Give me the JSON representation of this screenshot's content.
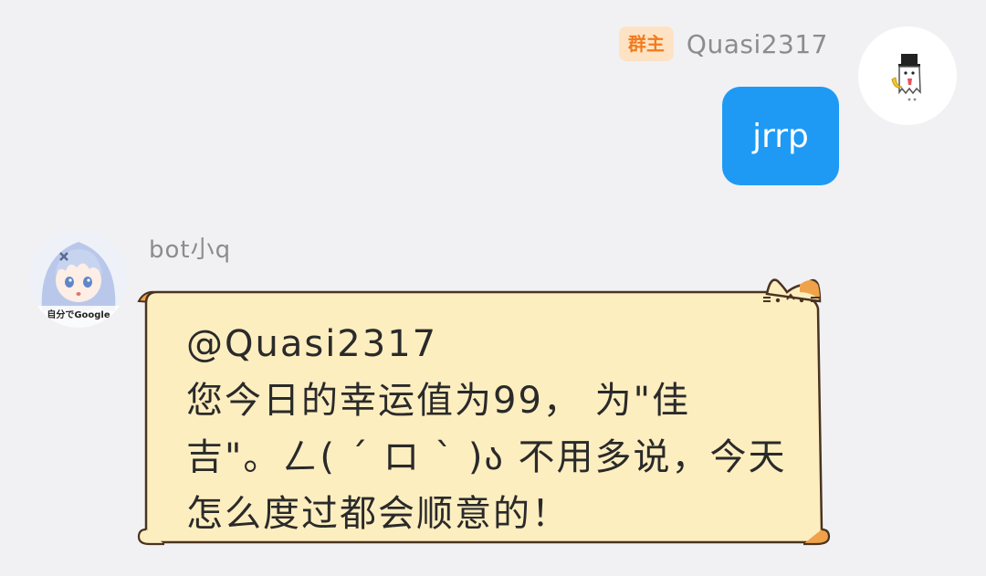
{
  "outgoing": {
    "role_badge": "群主",
    "sender_name": "Quasi2317",
    "message": "jrrp",
    "avatar_icon": "ghost-hat-icon",
    "bubble_color": "#1e9af5"
  },
  "incoming": {
    "sender_name": "bot小q",
    "avatar_caption": "自分でGoogle",
    "avatar_icon": "anime-girl-avatar",
    "bubble_color": "#fdeec0",
    "message_lines": [
      "@Quasi2317",
      "您今日的幸运值为99， 为\"佳",
      "吉\"。ㄥ( ´ ロ ` )ა 不用多说，今天",
      "怎么度过都会顺意的！"
    ]
  }
}
